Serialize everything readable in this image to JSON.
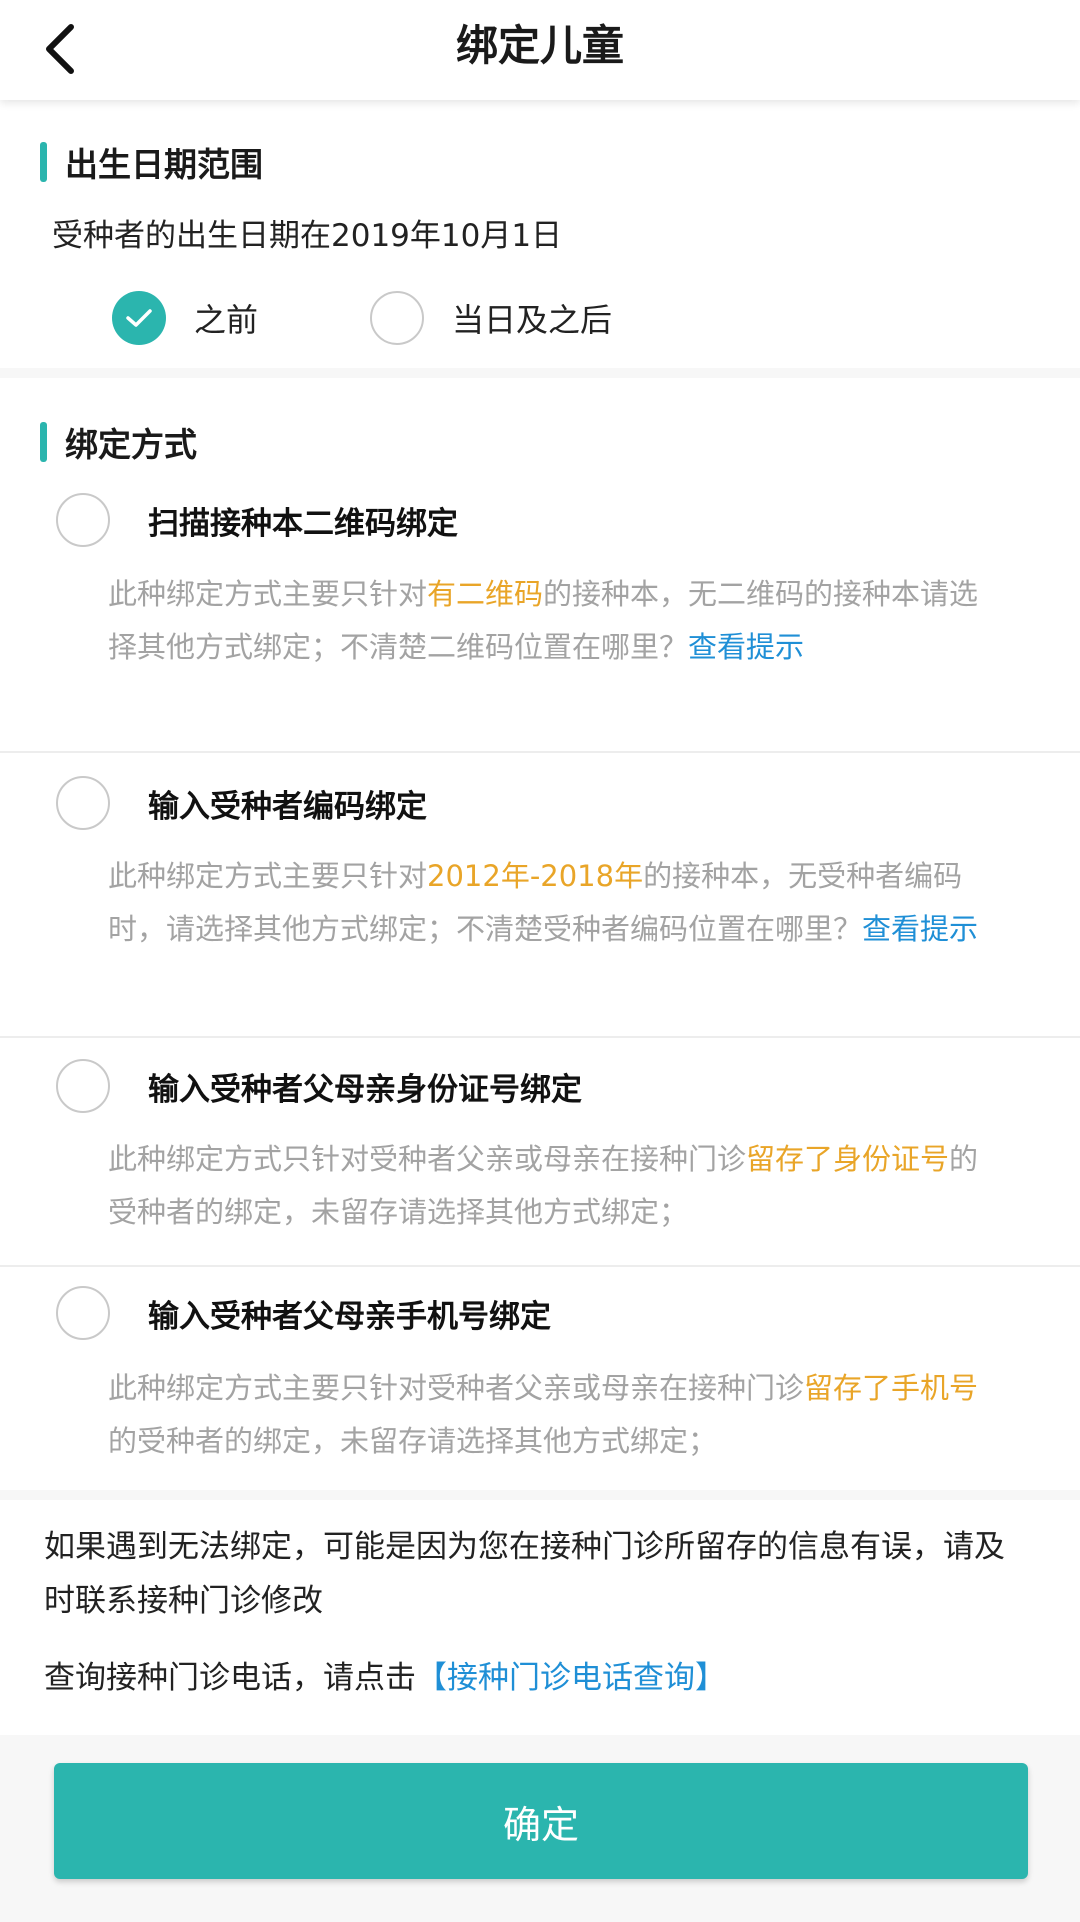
{
  "header": {
    "title": "绑定儿童",
    "back_icon": "chevron-left-icon"
  },
  "birth_range": {
    "title": "出生日期范围",
    "description": "受种者的出生日期在2019年10月1日",
    "options": [
      {
        "label": "之前",
        "checked": true
      },
      {
        "label": "当日及之后",
        "checked": false
      }
    ]
  },
  "bind_methods": {
    "title": "绑定方式",
    "items": [
      {
        "title": "扫描接种本二维码绑定",
        "checked": false,
        "desc_pre": "此种绑定方式主要只针对",
        "desc_highlight": "有二维码",
        "desc_post": "的接种本，无二维码的接种本请选择其他方式绑定；不清楚二维码位置在哪里？",
        "desc_link": "查看提示"
      },
      {
        "title": "输入受种者编码绑定",
        "checked": false,
        "desc_pre": "此种绑定方式主要只针对",
        "desc_highlight": "2012年-2018年",
        "desc_post": "的接种本，无受种者编码时，请选择其他方式绑定；不清楚受种者编码位置在哪里？",
        "desc_link": "查看提示"
      },
      {
        "title": "输入受种者父母亲身份证号绑定",
        "checked": false,
        "desc_pre": "此种绑定方式只针对受种者父亲或母亲在接种门诊",
        "desc_highlight": "留存了身份证号",
        "desc_post": "的受种者的绑定，未留存请选择其他方式绑定；",
        "desc_link": ""
      },
      {
        "title": "输入受种者父母亲手机号绑定",
        "checked": false,
        "desc_pre": "此种绑定方式主要只针对受种者父亲或母亲在接种门诊",
        "desc_highlight": "留存了手机号",
        "desc_post": "的受种者的绑定，未留存请选择其他方式绑定；",
        "desc_link": ""
      }
    ]
  },
  "notice": {
    "text": "如果遇到无法绑定，可能是因为您在接种门诊所留存的信息有误，请及时联系接种门诊修改",
    "phone_prefix": "查询接种门诊电话，请点击",
    "phone_link": "【接种门诊电话查询】"
  },
  "confirm_button": {
    "label": "确定"
  },
  "colors": {
    "accent": "#2bb5ae",
    "highlight": "#e9a528",
    "link": "#1f8fd6",
    "desc_text": "#a3a3a3"
  }
}
